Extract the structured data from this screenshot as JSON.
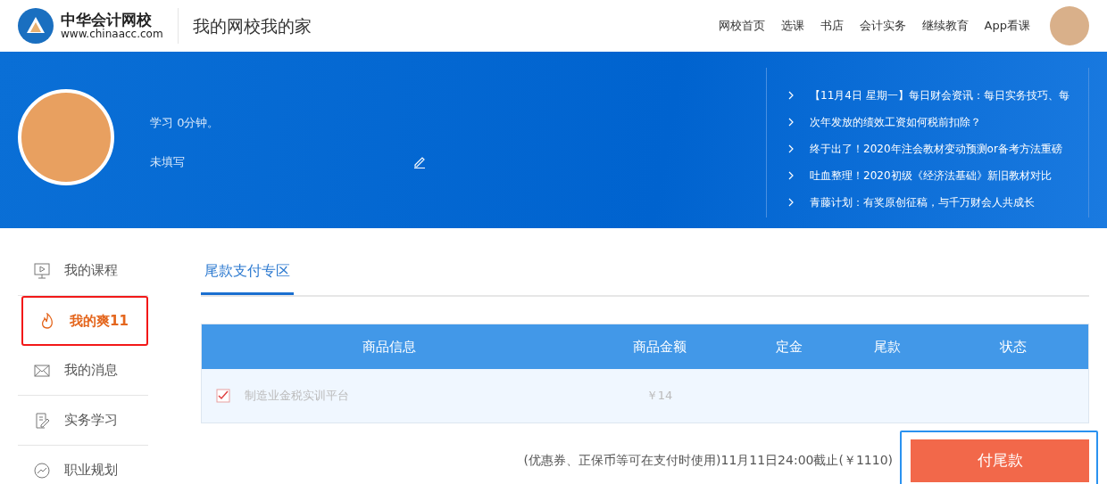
{
  "header": {
    "logo_title": "中华会计网校",
    "logo_url": "www.chinaacc.com",
    "slogan": "我的网校我的家",
    "nav": [
      "网校首页",
      "选课",
      "书店",
      "会计实务",
      "继续教育",
      "App看课"
    ]
  },
  "profile": {
    "study_time": "学习 0分钟。",
    "cert": "未填写"
  },
  "news": [
    "【11月4日 星期一】每日财会资讯：每日实务技巧、每",
    "次年发放的绩效工资如何税前扣除？",
    "终于出了！2020年注会教材变动预测or备考方法重磅",
    "吐血整理！2020初级《经济法基础》新旧教材对比",
    "青藤计划：有奖原创征稿，与千万财会人共成长"
  ],
  "sidebar": {
    "items": [
      {
        "label": "我的课程",
        "kind": "course",
        "selected": false
      },
      {
        "label": "我的爽11",
        "kind": "fire",
        "selected": true
      },
      {
        "label": "我的消息",
        "kind": "mail",
        "selected": false
      },
      {
        "label": "实务学习",
        "kind": "study",
        "selected": false
      },
      {
        "label": "职业规划",
        "kind": "plan",
        "selected": false
      }
    ]
  },
  "tabs": [
    {
      "label": "尾款支付专区",
      "selected": true
    }
  ],
  "table": {
    "columns": [
      "商品信息",
      "商品金额",
      "定金",
      "尾款",
      "状态"
    ],
    "rows": [
      {
        "checked": true,
        "product": "制造业金税实训平台",
        "amount": "￥14"
      }
    ]
  },
  "footer": {
    "note": "(优惠券、正保币等可在支付时使用)11月11日24:00截止(￥1110)",
    "pay_button": "付尾款"
  }
}
